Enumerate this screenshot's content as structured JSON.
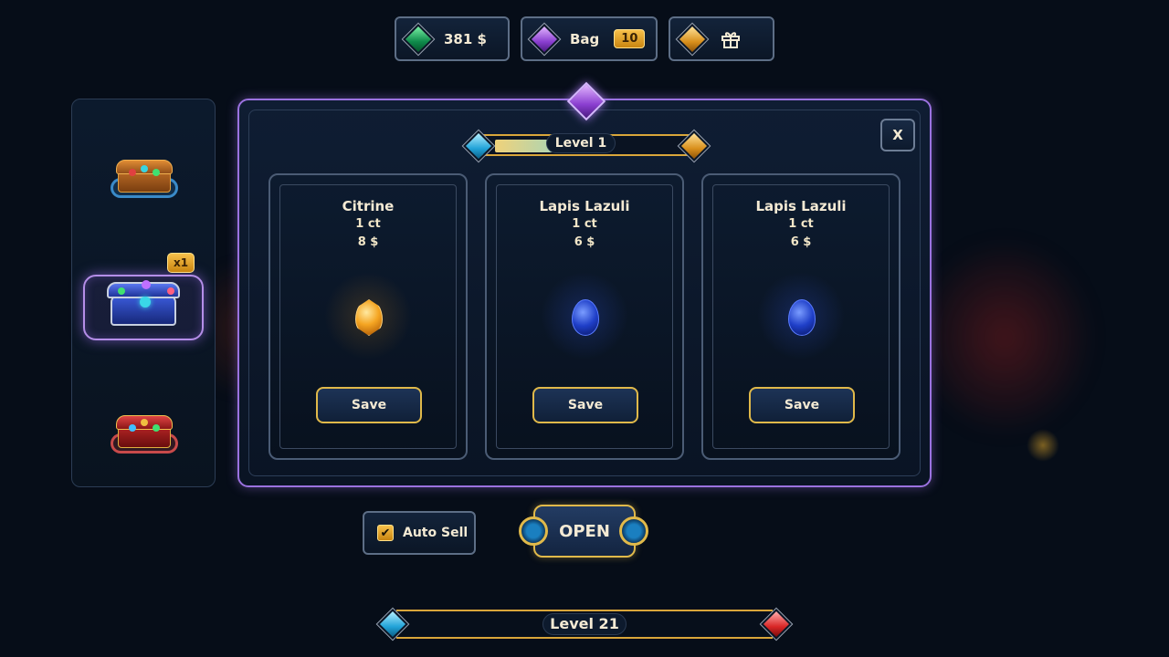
{
  "top_bar": {
    "currency": {
      "value": "381 $",
      "icon": "green-gem-icon"
    },
    "bag": {
      "label": "Bag",
      "count": "10",
      "icon": "purple-gem-icon"
    },
    "gift": {
      "icon": "gift-icon"
    }
  },
  "chests": [
    {
      "name": "wooden-chest",
      "selected": false,
      "rim_color": "#3a8ac8"
    },
    {
      "name": "sapphire-chest",
      "selected": true,
      "count": "x1",
      "rim_color": "#b58ee8"
    },
    {
      "name": "ruby-chest",
      "selected": false,
      "rim_color": "#c84a4a"
    }
  ],
  "panel": {
    "level_label": "Level 1",
    "level_progress": 0.55,
    "close_label": "X",
    "cards": [
      {
        "name": "Citrine",
        "weight": "1 ct",
        "price": "8 $",
        "gem": "citrine-icon",
        "save_label": "Save"
      },
      {
        "name": "Lapis Lazuli",
        "weight": "1 ct",
        "price": "6 $",
        "gem": "lapis-icon",
        "save_label": "Save"
      },
      {
        "name": "Lapis Lazuli",
        "weight": "1 ct",
        "price": "6 $",
        "gem": "lapis-icon",
        "save_label": "Save"
      }
    ]
  },
  "controls": {
    "auto_sell_label": "Auto Sell",
    "auto_sell_checked": true,
    "open_label": "OPEN"
  },
  "player_level": {
    "label": "Level 21"
  },
  "colors": {
    "accent_gold": "#e0b94a",
    "panel_border": "#9b72e0",
    "background": "#060d18"
  }
}
